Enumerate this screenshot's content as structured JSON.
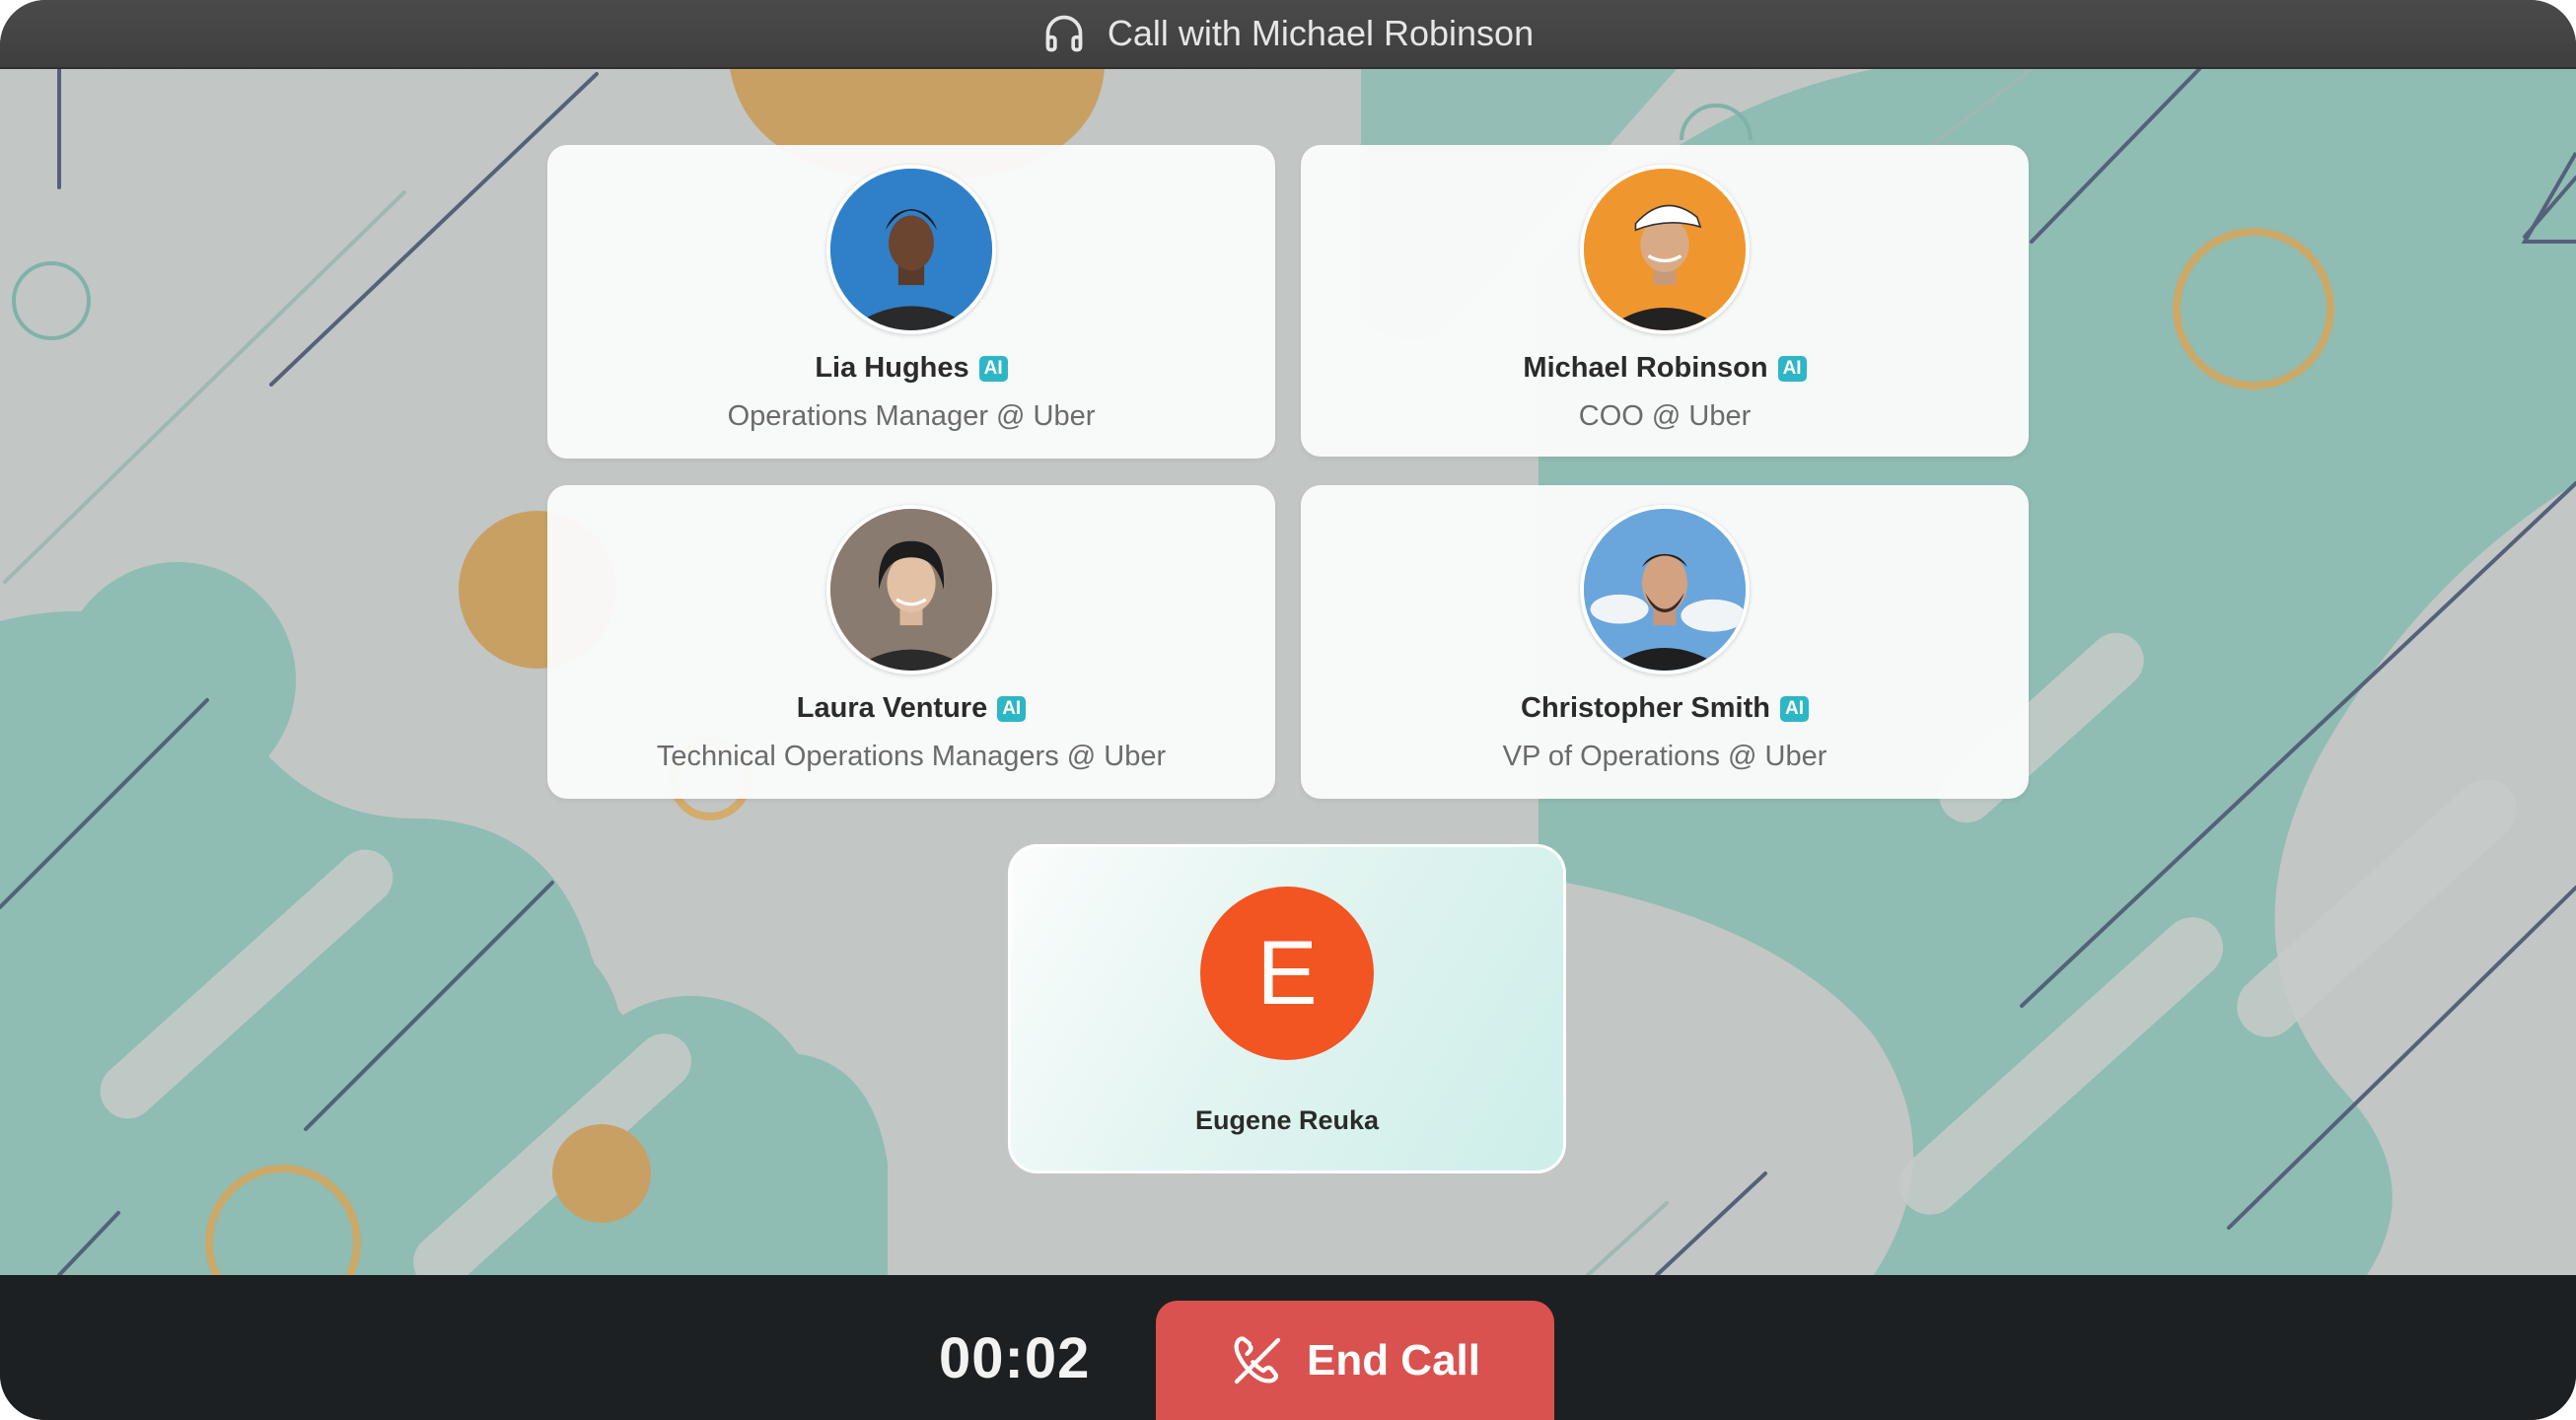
{
  "window": {
    "title": "Call with Michael Robinson",
    "title_icon": "headphones-icon"
  },
  "participants": [
    {
      "name": "Lia Hughes",
      "badge": "AI",
      "role": "Operations Manager @ Uber",
      "avatar_bg": "#2f7fc6"
    },
    {
      "name": "Michael Robinson",
      "badge": "AI",
      "role": "COO @ Uber",
      "avatar_bg": "#f0962e"
    },
    {
      "name": "Laura Venture",
      "badge": "AI",
      "role": "Technical Operations Managers @ Uber",
      "avatar_bg": "#8a7b70"
    },
    {
      "name": "Christopher Smith",
      "badge": "AI",
      "role": "VP of Operations @ Uber",
      "avatar_bg": "#5f9fd8"
    }
  ],
  "self": {
    "initial": "E",
    "name": "Eugene Reuka",
    "avatar_bg": "#f25422"
  },
  "controls": {
    "timer": "00:02",
    "end_call_label": "End Call",
    "end_call_icon": "phone-off-icon",
    "end_call_color": "#d9524f"
  }
}
